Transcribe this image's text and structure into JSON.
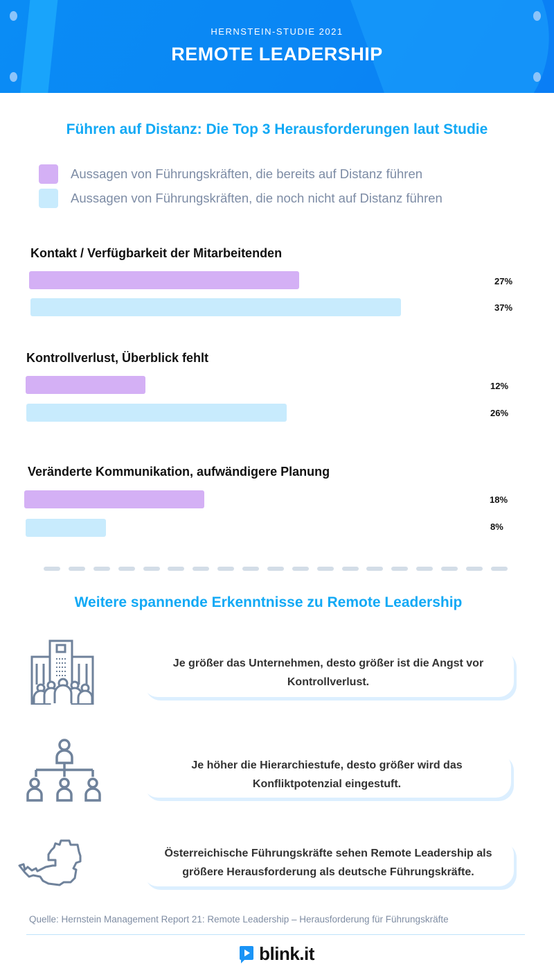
{
  "header": {
    "kicker": "HERNSTEIN-STUDIE 2021",
    "title": "REMOTE LEADERSHIP"
  },
  "chart_data": {
    "type": "bar",
    "title": "Führen auf Distanz: Die Top 3 Herausforderungen laut Studie",
    "xlabel": "",
    "ylabel": "",
    "unit": "%",
    "categories": [
      "Kontakt / Verfügbarkeit der Mitarbeitenden",
      "Kontrollverlust, Überblick fehlt",
      "Veränderte Kommunikation, aufwändigere Planung"
    ],
    "series": [
      {
        "name": "Aussagen von Führungskräften, die bereits auf Distanz führen",
        "color": "#d4b0f5",
        "values": [
          27,
          12,
          18
        ]
      },
      {
        "name": "Aussagen von Führungskräften, die noch nicht auf Distanz führen",
        "color": "#c8ebfd",
        "values": [
          37,
          26,
          8
        ]
      }
    ],
    "value_labels": [
      [
        "27%",
        "37%"
      ],
      [
        "12%",
        "26%"
      ],
      [
        "18%",
        "8%"
      ]
    ],
    "legend_position": "top-left",
    "grid": false
  },
  "insights": {
    "title": "Weitere spannende Erkenntnisse zu Remote Leadership",
    "items": [
      {
        "icon": "office-building-people-icon",
        "text": "Je größer das Unternehmen, desto größer ist die Angst vor Kontrollverlust."
      },
      {
        "icon": "hierarchy-org-chart-icon",
        "text": "Je höher die Hierarchiestufe, desto größer wird das Konfliktpotenzial eingestuft."
      },
      {
        "icon": "austria-map-icon",
        "text": "Österreichische Führungskräfte sehen Remote Leadership als größere Herausforderung als deutsche Führungskräfte."
      }
    ]
  },
  "footer": {
    "source": "Quelle: Hernstein Management Report 21: Remote Leadership – Herausforderung für Führungskräfte",
    "brand": "blink.it"
  },
  "colors": {
    "header_blue": "#0a86f4",
    "accent_title": "#12a9f5",
    "icon_gray": "#6f829b"
  }
}
